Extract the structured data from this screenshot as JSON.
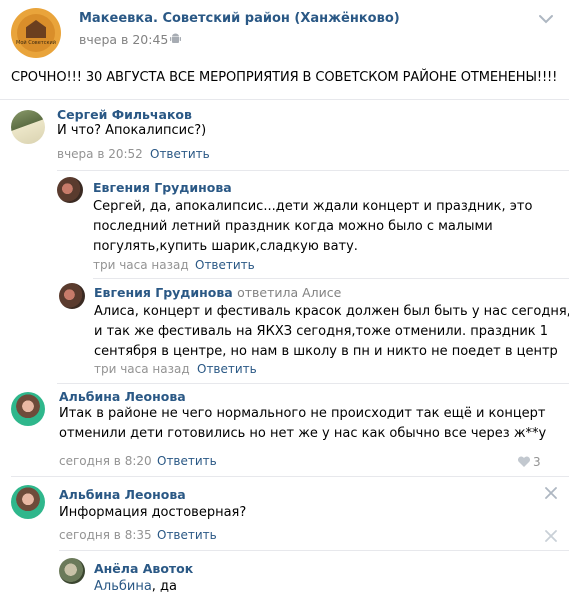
{
  "post": {
    "group_name": "Макеевка. Советский район (Ханжёнково)",
    "time": "вчера в 20:45",
    "avatar_text": "Мой Советский",
    "text": "СРОЧНО!!! 30 АВГУСТА ВСЕ МЕРОПРИЯТИЯ В СОВЕТСКОМ РАЙОНЕ ОТМЕНЕНЫ!!!!"
  },
  "comments": [
    {
      "author": "Сергей Фильчаков",
      "lines": [
        "И что? Апокалипсис?)"
      ],
      "time": "вчера в 20:52",
      "reply_label": "Ответить"
    },
    {
      "author": "Евгения Грудинова",
      "lines": [
        "Сергей, да, апокалипсис...дети ждали концерт и праздник, это",
        "последний летний праздник когда можно было с малыми",
        "погулять,купить шарик,сладкую вату."
      ],
      "time": "три часа назад",
      "reply_label": "Ответить"
    },
    {
      "author": "Евгения Грудинова",
      "replied_to": "ответила Алисе",
      "lines": [
        "Алиса, концерт и фестиваль красок должен был быть у нас сегодня,",
        "и так же фестиваль на ЯКХЗ сегодня,тоже отменили. праздник 1",
        "сентября в центре, но нам в школу в пн и никто не поедет в центр"
      ],
      "time": "три часа назад",
      "reply_label": "Ответить"
    },
    {
      "author": "Альбина Леонова",
      "lines": [
        "Итак в районе не чего нормального не происходит так ещё и концерт",
        "отменили дети готовились но нет же у нас как обычно все через ж**у"
      ],
      "time": "сегодня в 8:20",
      "reply_label": "Ответить",
      "likes": "3"
    },
    {
      "author": "Альбина Леонова",
      "lines": [
        "Информация достоверная?"
      ],
      "time": "сегодня в 8:35",
      "reply_label": "Ответить"
    },
    {
      "author": "Анёла Авоток",
      "reply_link": "Альбина",
      "rest": ", да"
    }
  ],
  "colors": {
    "link": "#2a5885",
    "meta": "#939393",
    "divider": "#e7e8ec"
  }
}
